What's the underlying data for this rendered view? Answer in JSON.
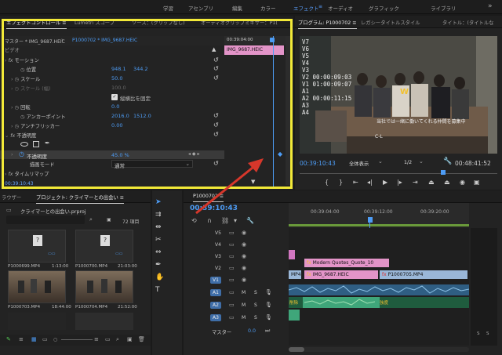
{
  "workspace_tabs": [
    "学習",
    "アセンブリ",
    "編集",
    "カラー",
    "エフェクト",
    "オーディオ",
    "グラフィック",
    "ライブラリ"
  ],
  "workspace_active": "エフェクト",
  "effect_controls": {
    "tabs": [
      "エフェクトコントロール ≡",
      "Lumetri スコープ",
      "ソース：(クリップなし)",
      "オーディオクリップミキサー：P1("
    ],
    "master_label": "マスター * IMG_9687.HEIC",
    "sequence_label": "P1000702 * IMG_9687.HEIC",
    "mini_timecode": "00:39:04:00",
    "clip_name": "IMG_9687.HEIC",
    "video_header": "ビデオ",
    "motion": "モーション",
    "position_label": "位置",
    "position_x": "948.1",
    "position_y": "344.2",
    "scale_label": "スケール",
    "scale_value": "50.0",
    "scale_width_label": "スケール (幅)",
    "scale_width_value": "100.0",
    "uniform_scale_label": "縦横比を固定",
    "rotation_label": "回転",
    "rotation_value": "0.0",
    "anchor_label": "アンカーポイント",
    "anchor_x": "2016.0",
    "anchor_y": "1512.0",
    "antiflicker_label": "アンチフリッカー",
    "antiflicker_value": "0.00",
    "opacity_section": "不透明度",
    "opacity_label": "不透明度",
    "opacity_value": "45.0 %",
    "blend_label": "描画モード",
    "blend_value": "通常",
    "time_remap": "タイムリマップ",
    "footer_time": "00:39:10:43"
  },
  "program_monitor": {
    "tabs": [
      "プログラム: P1000702 ≡",
      "レガシータイトルスタイル",
      "タイトル：(タイトルな"
    ],
    "track_overlay": [
      "V7",
      "V6",
      "V5",
      "V4",
      "V3",
      "V2 00:00:09:03",
      "V1 01:00:09:07",
      "A1",
      "A2 00:00:11:15",
      "A3",
      "A4"
    ],
    "subtitle": "当社では一緒に働いてくれる仲間を募集中",
    "cl_mark": "C-L",
    "timecode": "00:39:10:43",
    "fit_label": "全体表示",
    "quality": "1/2",
    "duration": "00:48:41:52"
  },
  "project_panel": {
    "tabs": [
      "ラウザー",
      "プロジェクト: クライマーとの出会い ≡"
    ],
    "project_file": "クライマーとの出会い.prproj",
    "item_count": "72 項目",
    "items": [
      {
        "name": "P1000699.MP4",
        "dur": "1:13:00"
      },
      {
        "name": "P1000700.MP4",
        "dur": "21:03:00"
      },
      {
        "name": "P1000703.MP4",
        "dur": "18:44:00"
      },
      {
        "name": "P1000704.MP4",
        "dur": "21:52:00"
      }
    ]
  },
  "timeline": {
    "tab": "P1000702 ≡",
    "timecode": "00:39:10:43",
    "ruler": [
      "00:39:04:00",
      "00:39:12:00",
      "00:39:20:00"
    ],
    "video_tracks": [
      "V5",
      "V4",
      "V3",
      "V2",
      "V1"
    ],
    "audio_tracks": [
      "A1",
      "A2",
      "A3"
    ],
    "master_label": "マスター",
    "master_value": "0.0",
    "clips": {
      "title": "Modern Quotes_Quote_10",
      "img": "IMG_9687.HEIC",
      "mp4_right": "P1000705.MP4",
      "mp4_left": "MP4",
      "audio_a": "削除",
      "audio_b": "強度"
    },
    "meter_scale": [
      "S",
      "S"
    ]
  },
  "colors": {
    "accent_blue": "#4d9cf5",
    "highlight_yellow": "#f2e938",
    "arrow_red": "#d6372b",
    "clip_pink": "#e394c8",
    "clip_video": "#9ab7d8",
    "clip_audio": "#3fa67a",
    "clip_green": "#8fd18c"
  }
}
